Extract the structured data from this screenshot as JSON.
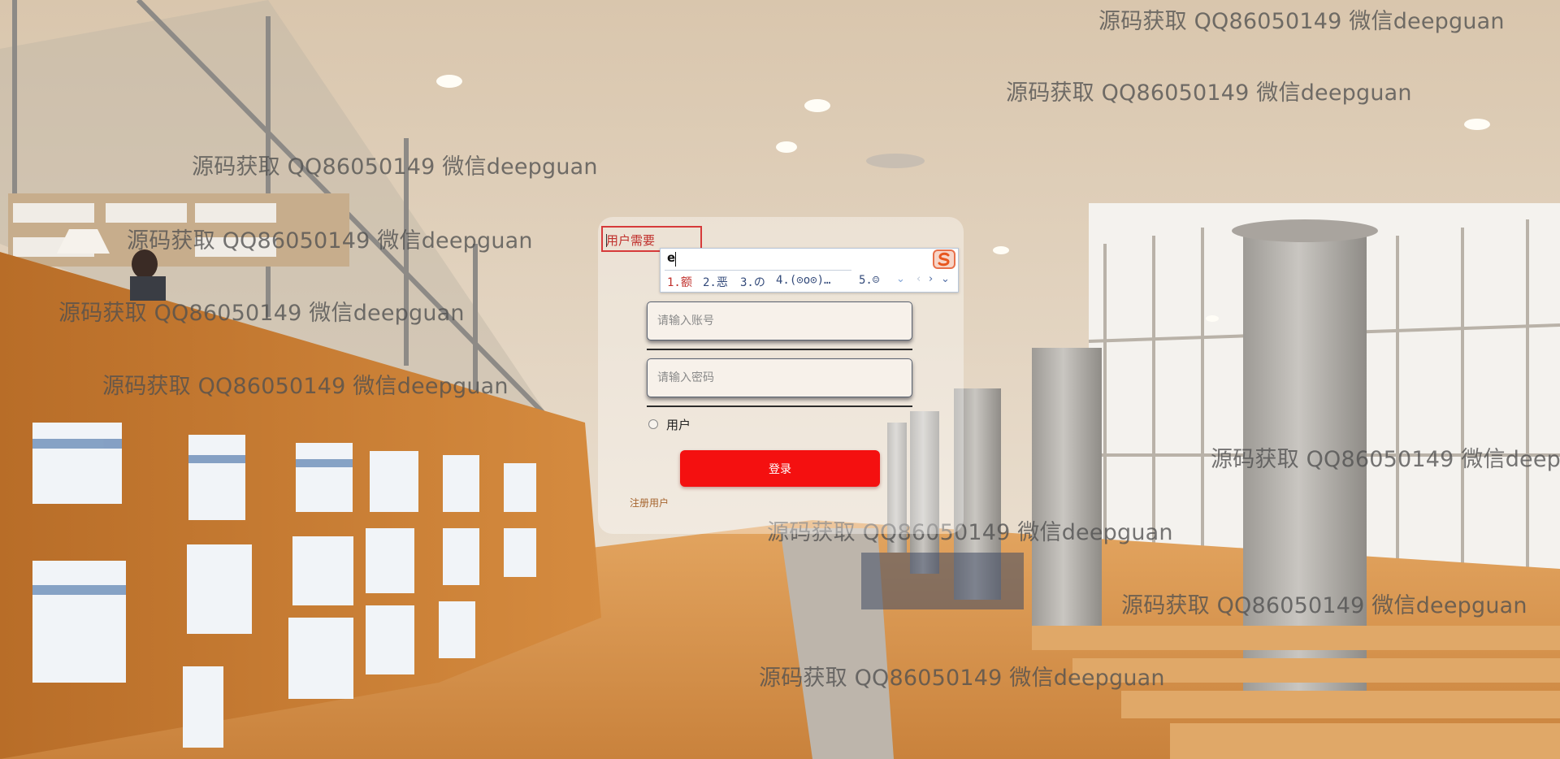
{
  "watermark": "源码获取 QQ86050149 微信deepguan",
  "login": {
    "card_title": "用户需要",
    "account_placeholder": "请输入账号",
    "password_placeholder": "请输入密码",
    "role_label": "用户",
    "login_button": "登录",
    "register_link": "注册用户"
  },
  "ime": {
    "input": "e",
    "candidates": [
      "1.额",
      "2.恶",
      "3.の",
      "4.(⊙o⊙)…",
      "5.☺"
    ],
    "controls": {
      "down": "⌄",
      "prev": "‹",
      "next": "›",
      "more": "⌄"
    },
    "logo_icon": "sogou-s-logo"
  },
  "colors": {
    "login_button": "#f41010",
    "register_link": "#a5642e",
    "title_border": "#d63a3a"
  }
}
